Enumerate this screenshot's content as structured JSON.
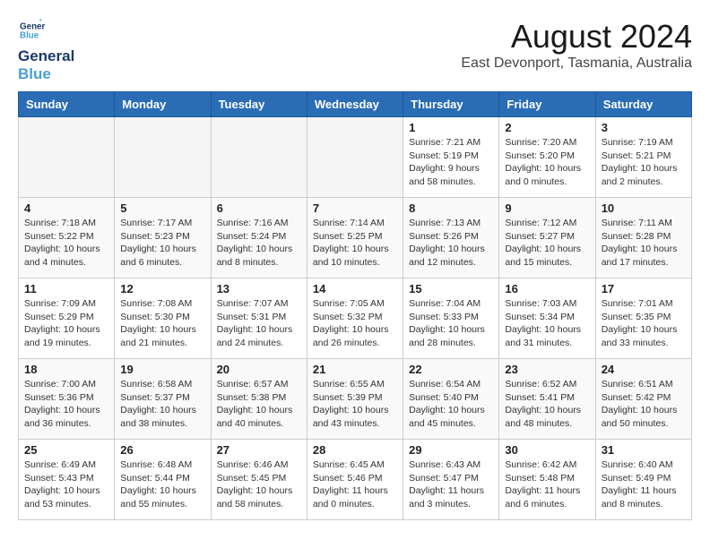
{
  "header": {
    "logo_line1": "General",
    "logo_line2": "Blue",
    "title": "August 2024",
    "subtitle": "East Devonport, Tasmania, Australia"
  },
  "days_of_week": [
    "Sunday",
    "Monday",
    "Tuesday",
    "Wednesday",
    "Thursday",
    "Friday",
    "Saturday"
  ],
  "weeks": [
    [
      {
        "day": "",
        "info": ""
      },
      {
        "day": "",
        "info": ""
      },
      {
        "day": "",
        "info": ""
      },
      {
        "day": "",
        "info": ""
      },
      {
        "day": "1",
        "info": "Sunrise: 7:21 AM\nSunset: 5:19 PM\nDaylight: 9 hours\nand 58 minutes."
      },
      {
        "day": "2",
        "info": "Sunrise: 7:20 AM\nSunset: 5:20 PM\nDaylight: 10 hours\nand 0 minutes."
      },
      {
        "day": "3",
        "info": "Sunrise: 7:19 AM\nSunset: 5:21 PM\nDaylight: 10 hours\nand 2 minutes."
      }
    ],
    [
      {
        "day": "4",
        "info": "Sunrise: 7:18 AM\nSunset: 5:22 PM\nDaylight: 10 hours\nand 4 minutes."
      },
      {
        "day": "5",
        "info": "Sunrise: 7:17 AM\nSunset: 5:23 PM\nDaylight: 10 hours\nand 6 minutes."
      },
      {
        "day": "6",
        "info": "Sunrise: 7:16 AM\nSunset: 5:24 PM\nDaylight: 10 hours\nand 8 minutes."
      },
      {
        "day": "7",
        "info": "Sunrise: 7:14 AM\nSunset: 5:25 PM\nDaylight: 10 hours\nand 10 minutes."
      },
      {
        "day": "8",
        "info": "Sunrise: 7:13 AM\nSunset: 5:26 PM\nDaylight: 10 hours\nand 12 minutes."
      },
      {
        "day": "9",
        "info": "Sunrise: 7:12 AM\nSunset: 5:27 PM\nDaylight: 10 hours\nand 15 minutes."
      },
      {
        "day": "10",
        "info": "Sunrise: 7:11 AM\nSunset: 5:28 PM\nDaylight: 10 hours\nand 17 minutes."
      }
    ],
    [
      {
        "day": "11",
        "info": "Sunrise: 7:09 AM\nSunset: 5:29 PM\nDaylight: 10 hours\nand 19 minutes."
      },
      {
        "day": "12",
        "info": "Sunrise: 7:08 AM\nSunset: 5:30 PM\nDaylight: 10 hours\nand 21 minutes."
      },
      {
        "day": "13",
        "info": "Sunrise: 7:07 AM\nSunset: 5:31 PM\nDaylight: 10 hours\nand 24 minutes."
      },
      {
        "day": "14",
        "info": "Sunrise: 7:05 AM\nSunset: 5:32 PM\nDaylight: 10 hours\nand 26 minutes."
      },
      {
        "day": "15",
        "info": "Sunrise: 7:04 AM\nSunset: 5:33 PM\nDaylight: 10 hours\nand 28 minutes."
      },
      {
        "day": "16",
        "info": "Sunrise: 7:03 AM\nSunset: 5:34 PM\nDaylight: 10 hours\nand 31 minutes."
      },
      {
        "day": "17",
        "info": "Sunrise: 7:01 AM\nSunset: 5:35 PM\nDaylight: 10 hours\nand 33 minutes."
      }
    ],
    [
      {
        "day": "18",
        "info": "Sunrise: 7:00 AM\nSunset: 5:36 PM\nDaylight: 10 hours\nand 36 minutes."
      },
      {
        "day": "19",
        "info": "Sunrise: 6:58 AM\nSunset: 5:37 PM\nDaylight: 10 hours\nand 38 minutes."
      },
      {
        "day": "20",
        "info": "Sunrise: 6:57 AM\nSunset: 5:38 PM\nDaylight: 10 hours\nand 40 minutes."
      },
      {
        "day": "21",
        "info": "Sunrise: 6:55 AM\nSunset: 5:39 PM\nDaylight: 10 hours\nand 43 minutes."
      },
      {
        "day": "22",
        "info": "Sunrise: 6:54 AM\nSunset: 5:40 PM\nDaylight: 10 hours\nand 45 minutes."
      },
      {
        "day": "23",
        "info": "Sunrise: 6:52 AM\nSunset: 5:41 PM\nDaylight: 10 hours\nand 48 minutes."
      },
      {
        "day": "24",
        "info": "Sunrise: 6:51 AM\nSunset: 5:42 PM\nDaylight: 10 hours\nand 50 minutes."
      }
    ],
    [
      {
        "day": "25",
        "info": "Sunrise: 6:49 AM\nSunset: 5:43 PM\nDaylight: 10 hours\nand 53 minutes."
      },
      {
        "day": "26",
        "info": "Sunrise: 6:48 AM\nSunset: 5:44 PM\nDaylight: 10 hours\nand 55 minutes."
      },
      {
        "day": "27",
        "info": "Sunrise: 6:46 AM\nSunset: 5:45 PM\nDaylight: 10 hours\nand 58 minutes."
      },
      {
        "day": "28",
        "info": "Sunrise: 6:45 AM\nSunset: 5:46 PM\nDaylight: 11 hours\nand 0 minutes."
      },
      {
        "day": "29",
        "info": "Sunrise: 6:43 AM\nSunset: 5:47 PM\nDaylight: 11 hours\nand 3 minutes."
      },
      {
        "day": "30",
        "info": "Sunrise: 6:42 AM\nSunset: 5:48 PM\nDaylight: 11 hours\nand 6 minutes."
      },
      {
        "day": "31",
        "info": "Sunrise: 6:40 AM\nSunset: 5:49 PM\nDaylight: 11 hours\nand 8 minutes."
      }
    ]
  ]
}
